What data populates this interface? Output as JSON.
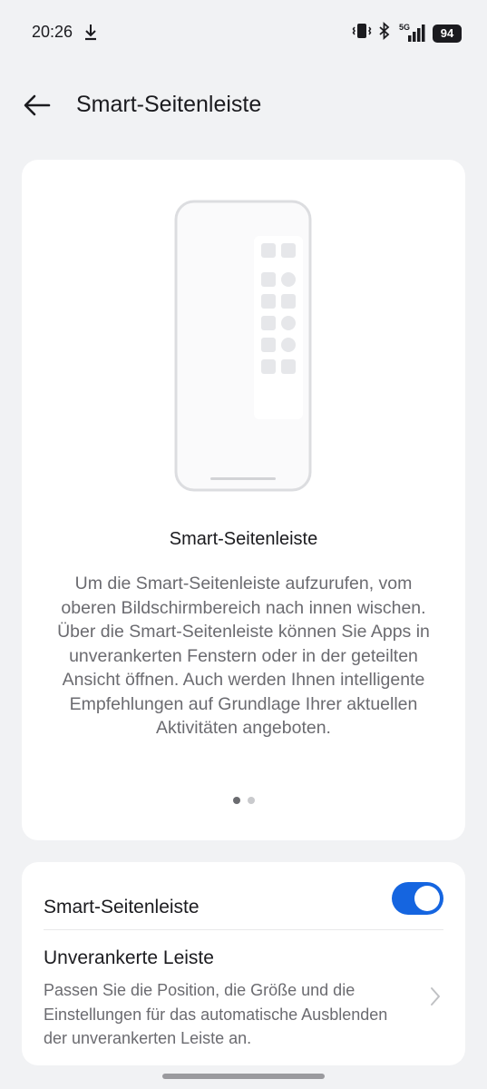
{
  "status_bar": {
    "time": "20:26",
    "network": "5G",
    "battery": "94"
  },
  "header": {
    "title": "Smart-Seitenleiste"
  },
  "hero": {
    "title": "Smart-Seitenleiste",
    "description": "Um die Smart-Seitenleiste aufzurufen, vom oberen Bildschirmbereich nach innen wischen. Über die Smart-Seitenleiste können Sie Apps in unverankerten Fenstern oder in der geteilten Ansicht öffnen. Auch werden Ihnen intelligente Empfehlungen auf Grundlage Ihrer aktuellen Aktivitäten angeboten.",
    "pager": {
      "pages": 2,
      "current": 1
    }
  },
  "settings": {
    "toggle_label": "Smart-Seitenleiste",
    "toggle_on": true,
    "floating_title": "Unverankerte Leiste",
    "floating_desc": "Passen Sie die Position, die Größe und die Einstellungen für das automatische Ausblenden der unverankerten Leiste an."
  },
  "colors": {
    "accent": "#1565e0",
    "background": "#f1f2f4",
    "card": "#ffffff",
    "secondary_text": "#6b6b70"
  }
}
